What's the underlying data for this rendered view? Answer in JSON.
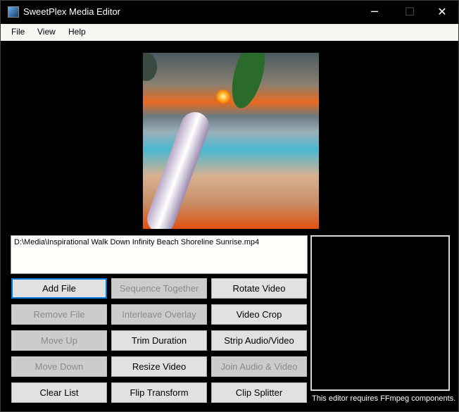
{
  "window": {
    "title": "SweetPlex Media Editor",
    "minimize": "─",
    "maximize": "☐",
    "close": "✕"
  },
  "menu": [
    "File",
    "View",
    "Help"
  ],
  "file_list": [
    "D:\\Media\\Inspirational Walk Down Infinity Beach Shoreline Sunrise.mp4"
  ],
  "buttons": [
    {
      "label": "Add File",
      "enabled": true,
      "focused": true
    },
    {
      "label": "Sequence Together",
      "enabled": false
    },
    {
      "label": "Rotate Video",
      "enabled": true
    },
    {
      "label": "Remove File",
      "enabled": false
    },
    {
      "label": "Interleave Overlay",
      "enabled": false
    },
    {
      "label": "Video Crop",
      "enabled": true
    },
    {
      "label": "Move Up",
      "enabled": false
    },
    {
      "label": "Trim Duration",
      "enabled": true
    },
    {
      "label": "Strip Audio/Video",
      "enabled": true
    },
    {
      "label": "Move Down",
      "enabled": false
    },
    {
      "label": "Resize Video",
      "enabled": true
    },
    {
      "label": "Join Audio & Video",
      "enabled": false
    },
    {
      "label": "Clear List",
      "enabled": true
    },
    {
      "label": "Flip Transform",
      "enabled": true
    },
    {
      "label": "Clip Splitter",
      "enabled": true
    }
  ],
  "status_note": "This editor requires FFmpeg components."
}
